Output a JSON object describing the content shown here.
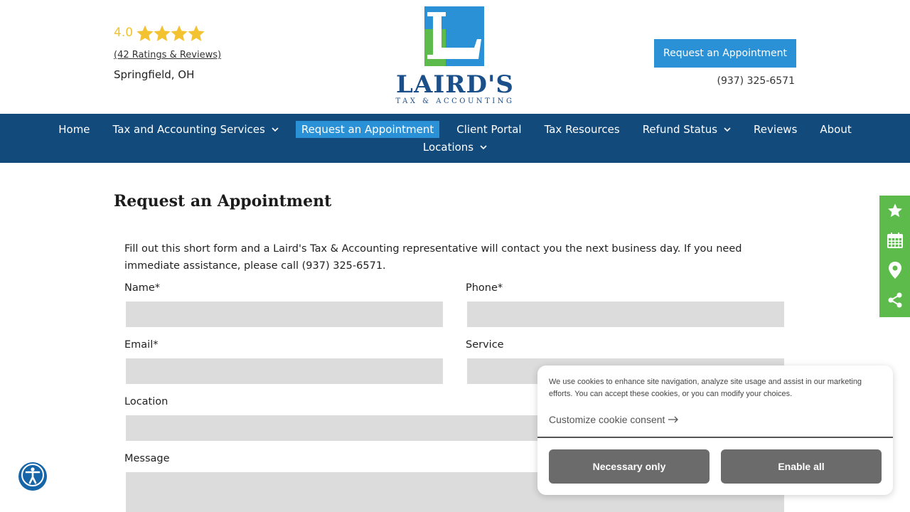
{
  "header": {
    "rating_score": "4.0",
    "star_count": 4,
    "reviews_link": "(42 Ratings & Reviews)",
    "location": "Springfield, OH",
    "logo_word": "LAIRD'S",
    "logo_sub": "TAX & ACCOUNTING",
    "cta_label": "Request an Appointment",
    "phone": "(937) 325-6571"
  },
  "nav": {
    "row1": [
      {
        "label": "Home",
        "dropdown": false
      },
      {
        "label": "Tax and Accounting Services",
        "dropdown": true
      },
      {
        "label": "Request an Appointment",
        "dropdown": false,
        "active": true
      },
      {
        "label": "Client Portal",
        "dropdown": false
      },
      {
        "label": "Tax Resources",
        "dropdown": false
      },
      {
        "label": "Refund Status",
        "dropdown": true
      },
      {
        "label": "Reviews",
        "dropdown": false
      },
      {
        "label": "About",
        "dropdown": false
      }
    ],
    "row2": [
      {
        "label": "Locations",
        "dropdown": true
      }
    ]
  },
  "main": {
    "title": "Request an Appointment",
    "intro": "Fill out this short form and a Laird's Tax & Accounting representative will contact you the next business day. If you need immediate assistance, please call (937) 325-6571.",
    "form": {
      "name_label": "Name*",
      "phone_label": "Phone*",
      "email_label": "Email*",
      "service_label": "Service",
      "location_label": "Location",
      "message_label": "Message"
    }
  },
  "sidebar": {
    "icons": [
      "star-icon",
      "calendar-icon",
      "map-pin-icon",
      "share-icon"
    ]
  },
  "cookie": {
    "text": "We use cookies to enhance site navigation, analyze site usage and assist in our marketing efforts. You can accept these cookies, or you can modify your choices.",
    "customize_label": "Customize cookie consent",
    "necessary_label": "Necessary only",
    "enable_label": "Enable all"
  },
  "colors": {
    "nav_bg": "#124a7c",
    "accent_blue": "#2b91d6",
    "star_yellow": "#f2c230",
    "sidebar_green": "#5cbb4a",
    "logo_green": "#5cbb4a",
    "logo_blue": "#2b91d6"
  }
}
